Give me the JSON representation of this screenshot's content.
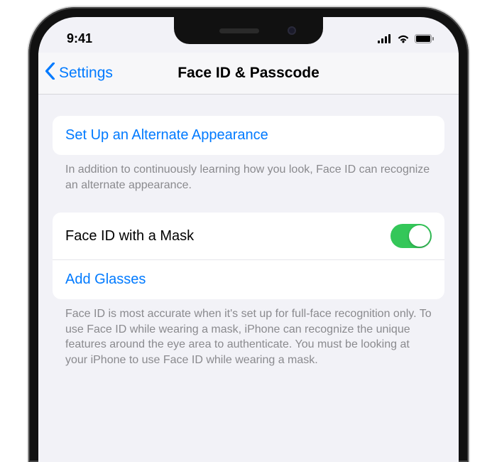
{
  "status": {
    "time": "9:41"
  },
  "nav": {
    "back_label": "Settings",
    "title": "Face ID & Passcode"
  },
  "group1": {
    "alternate_label": "Set Up an Alternate Appearance",
    "footer": "In addition to continuously learning how you look, Face ID can recognize an alternate appearance."
  },
  "group2": {
    "mask_label": "Face ID with a Mask",
    "mask_on": true,
    "add_glasses_label": "Add Glasses",
    "footer": "Face ID is most accurate when it's set up for full-face recognition only. To use Face ID while wearing a mask, iPhone can recognize the unique features around the eye area to authenticate. You must be looking at your iPhone to use Face ID while wearing a mask."
  },
  "colors": {
    "link": "#007aff",
    "toggle_on": "#34c759"
  }
}
